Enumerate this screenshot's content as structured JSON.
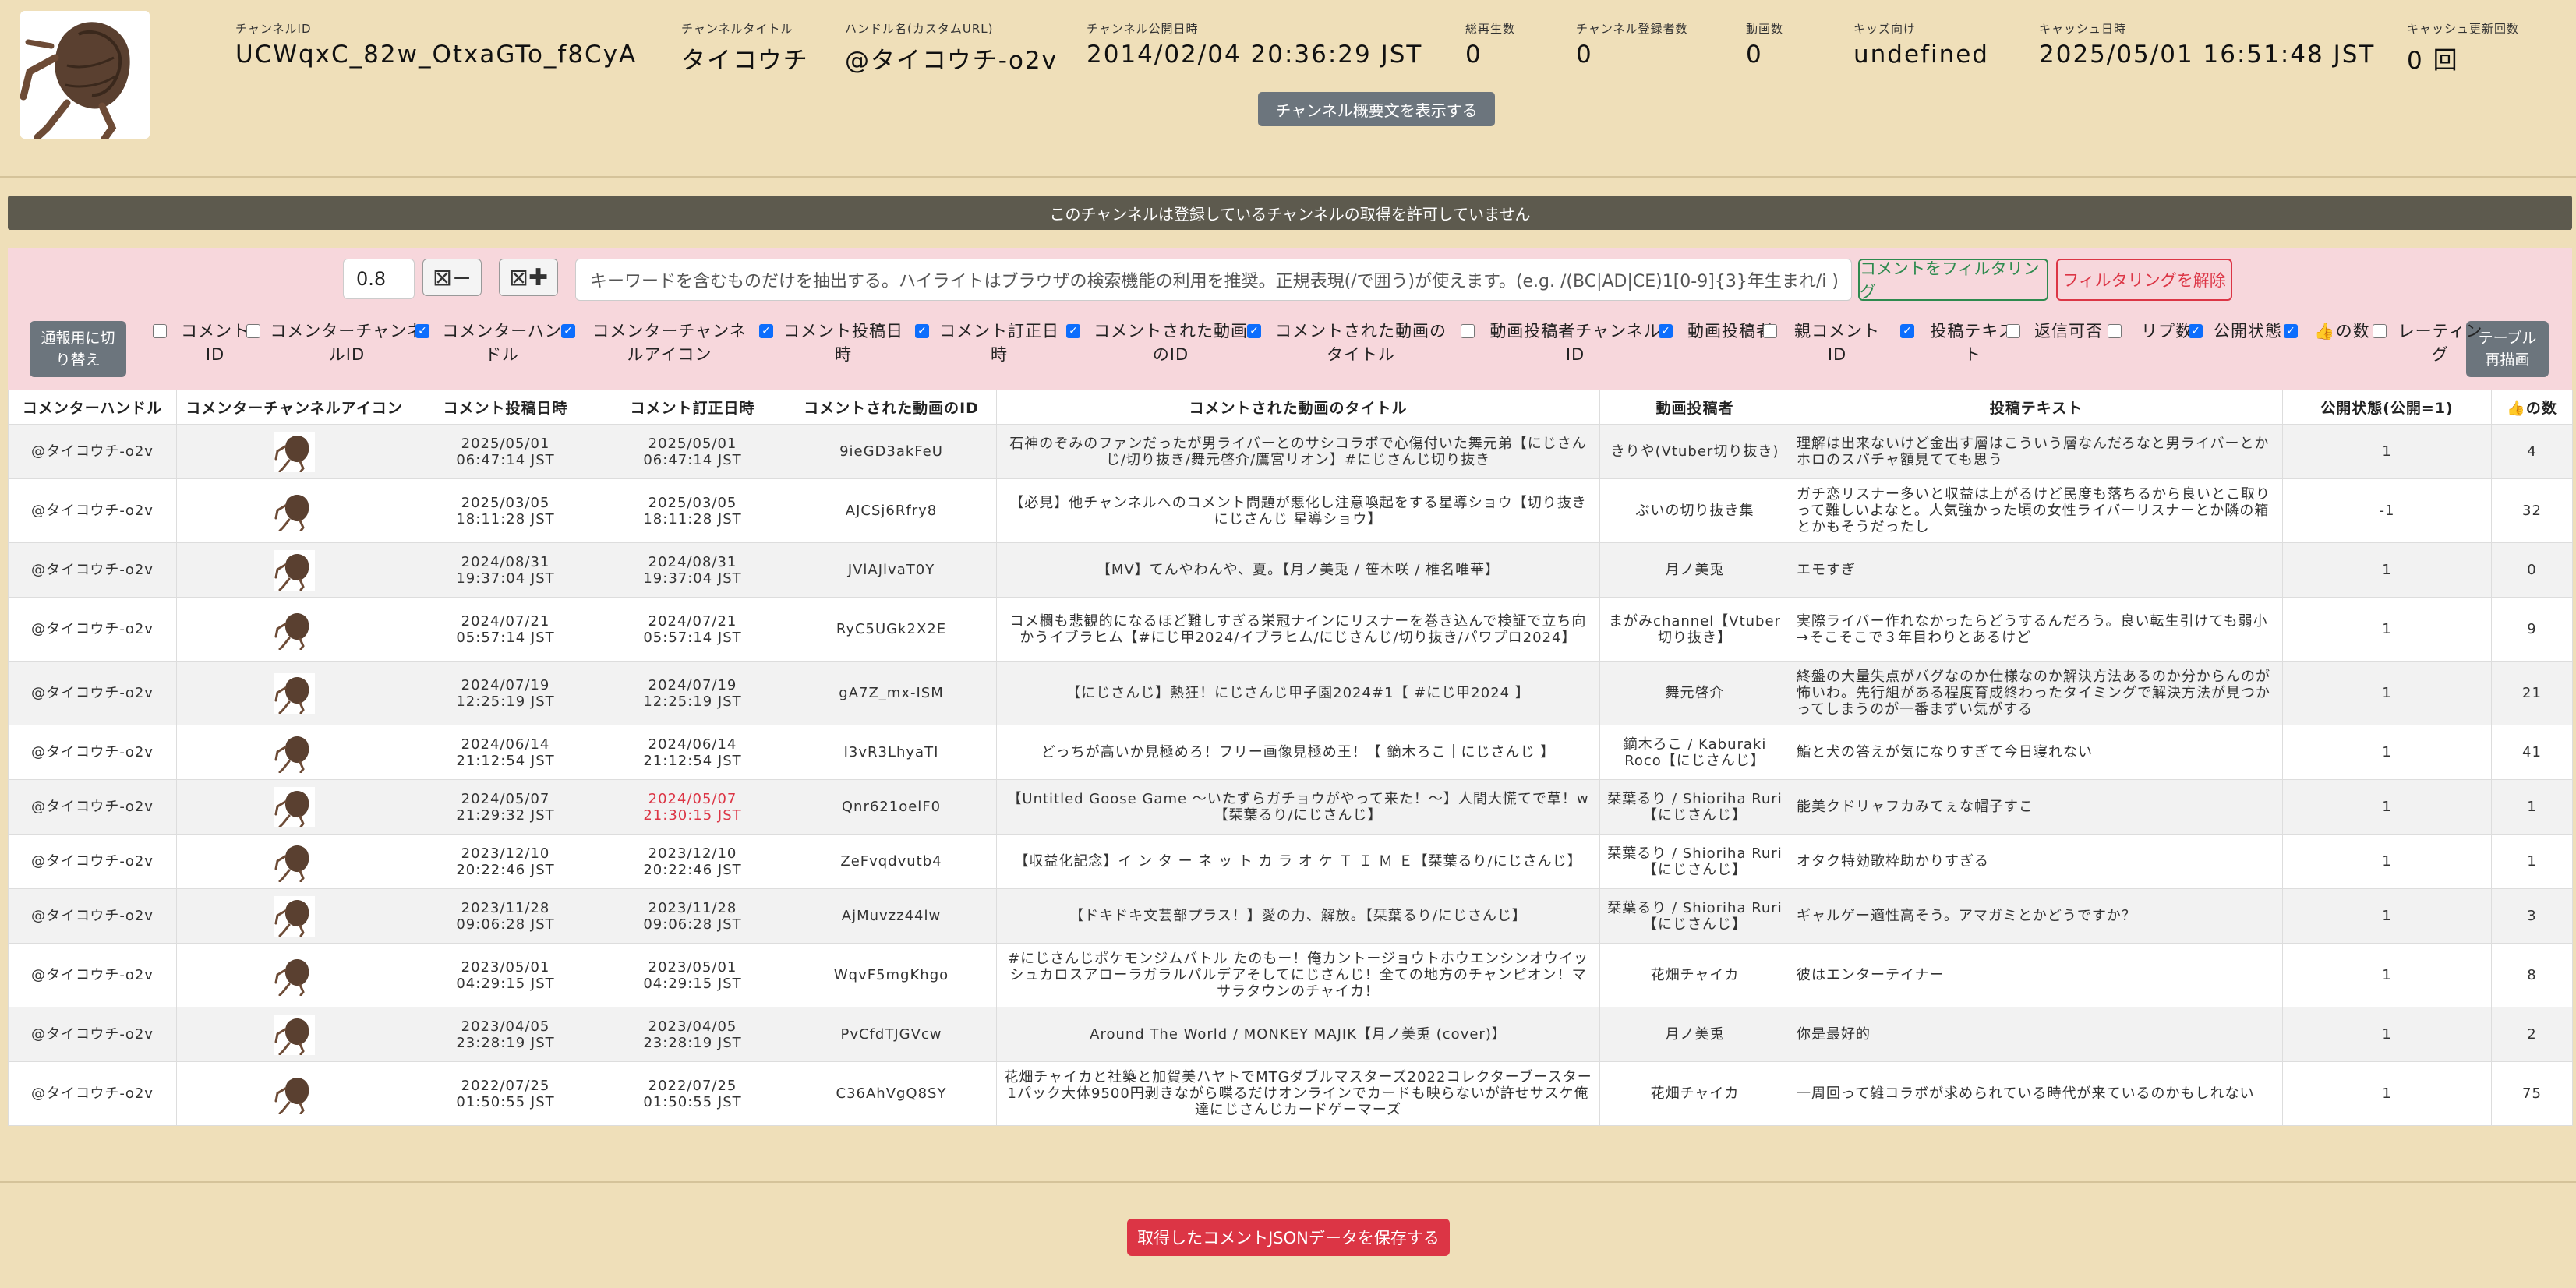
{
  "header": {
    "fields": [
      {
        "label": "チャンネルID",
        "value": "UCWqxC_82w_OtxaGTo_f8CyA"
      },
      {
        "label": "チャンネルタイトル",
        "value": "タイコウチ"
      },
      {
        "label": "ハンドル名(カスタムURL)",
        "value": "@タイコウチ-o2v"
      },
      {
        "label": "チャンネル公開日時",
        "value": "2014/02/04 20:36:29 JST"
      },
      {
        "label": "総再生数",
        "value": "0"
      },
      {
        "label": "チャンネル登録者数",
        "value": "0"
      },
      {
        "label": "動画数",
        "value": "0"
      },
      {
        "label": "キッズ向け",
        "value": "undefined"
      },
      {
        "label": "キャッシュ日時",
        "value": "2025/05/01 16:51:48 JST"
      },
      {
        "label": "キャッシュ更新回数",
        "value": "0 回"
      }
    ],
    "description_button": "チャンネル概要文を表示する"
  },
  "notice": "このチャンネルは登録しているチャンネルの取得を許可していません",
  "filter": {
    "threshold": "0.8",
    "shrink_button": "⊠−",
    "expand_button": "⊠✚",
    "keyword_placeholder": "キーワードを含むものだけを抽出する。ハイライトはブラウザの検索機能の利用を推奨。正規表現(/で囲う)が使えます。(e.g. /(BC|AD|CE)1[0-9]{3}年生まれ/i )",
    "filter_button": "コメントをフィルタリング",
    "clear_button": "フィルタリングを解除",
    "toggle_button": "通報用に切り替え",
    "redraw_button": "テーブル再描画"
  },
  "columns": [
    {
      "label": "コメントID",
      "checked": false
    },
    {
      "label": "コメンターチャンネルID",
      "checked": false
    },
    {
      "label": "コメンターハンドル",
      "checked": true
    },
    {
      "label": "コメンターチャンネルアイコン",
      "checked": true
    },
    {
      "label": "コメント投稿日時",
      "checked": true
    },
    {
      "label": "コメント訂正日時",
      "checked": true
    },
    {
      "label": "コメントされた動画のID",
      "checked": true
    },
    {
      "label": "コメントされた動画のタイトル",
      "checked": true
    },
    {
      "label": "動画投稿者チャンネルID",
      "checked": false
    },
    {
      "label": "動画投稿者",
      "checked": true
    },
    {
      "label": "親コメントID",
      "checked": false
    },
    {
      "label": "投稿テキスト",
      "checked": true
    },
    {
      "label": "返信可否",
      "checked": false
    },
    {
      "label": "リプ数",
      "checked": false
    },
    {
      "label": "公開状態",
      "checked": true
    },
    {
      "label": "👍の数",
      "checked": true
    },
    {
      "label": "レーティング",
      "checked": false
    }
  ],
  "table": {
    "headers": [
      "コメンターハンドル",
      "コメンターチャンネルアイコン",
      "コメント投稿日時",
      "コメント訂正日時",
      "コメントされた動画のID",
      "コメントされた動画のタイトル",
      "動画投稿者",
      "投稿テキスト",
      "公開状態(公開=1)",
      "👍の数"
    ],
    "rows": [
      {
        "handle": "@タイコウチ-o2v",
        "posted": [
          "2025/05/01",
          "06:47:14 JST"
        ],
        "edited": [
          "2025/05/01",
          "06:47:14 JST"
        ],
        "edited_changed": false,
        "video_id": "9ieGD3akFeU",
        "title": "石神のぞみのファンだったが男ライバーとのサシコラボで心傷付いた舞元弟【にじさんじ/切り抜き/舞元啓介/鷹宮リオン】#にじさんじ切り抜き",
        "uploader": "きりや(Vtuber切り抜き)",
        "text": "理解は出来ないけど金出す層はこういう層なんだろなと男ライバーとかホロのスバチャ額見てても思う",
        "status": "1",
        "likes": "4"
      },
      {
        "handle": "@タイコウチ-o2v",
        "posted": [
          "2025/03/05",
          "18:11:28 JST"
        ],
        "edited": [
          "2025/03/05",
          "18:11:28 JST"
        ],
        "edited_changed": false,
        "video_id": "AJCSj6Rfry8",
        "title": "【必見】他チャンネルへのコメント問題が悪化し注意喚起をする星導ショウ【切り抜き にじさんじ 星導ショウ】",
        "uploader": "ぶいの切り抜き集",
        "text": "ガチ恋リスナー多いと収益は上がるけど民度も落ちるから良いとこ取りって難しいよなと。人気強かった頃の女性ライバーリスナーとか隣の箱とかもそうだったし",
        "status": "-1",
        "likes": "32"
      },
      {
        "handle": "@タイコウチ-o2v",
        "posted": [
          "2024/08/31",
          "19:37:04 JST"
        ],
        "edited": [
          "2024/08/31",
          "19:37:04 JST"
        ],
        "edited_changed": false,
        "video_id": "JVlAJlvaT0Y",
        "title": "【MV】てんやわんや、夏。【月ノ美兎 / 笹木咲 / 椎名唯華】",
        "uploader": "月ノ美兎",
        "text": "エモすぎ",
        "status": "1",
        "likes": "0"
      },
      {
        "handle": "@タイコウチ-o2v",
        "posted": [
          "2024/07/21",
          "05:57:14 JST"
        ],
        "edited": [
          "2024/07/21",
          "05:57:14 JST"
        ],
        "edited_changed": false,
        "video_id": "RyC5UGk2X2E",
        "title": "コメ欄も悲観的になるほど難しすぎる栄冠ナインにリスナーを巻き込んで検証で立ち向かうイブラヒム【#にじ甲2024/イブラヒム/にじさんじ/切り抜き/パワプロ2024】",
        "uploader": "まがみchannel【Vtuber切り抜き】",
        "text": "実際ライバー作れなかったらどうするんだろう。良い転生引けても弱小→そこそこで３年目わりとあるけど",
        "status": "1",
        "likes": "9"
      },
      {
        "handle": "@タイコウチ-o2v",
        "posted": [
          "2024/07/19",
          "12:25:19 JST"
        ],
        "edited": [
          "2024/07/19",
          "12:25:19 JST"
        ],
        "edited_changed": false,
        "video_id": "gA7Z_mx-ISM",
        "title": "【にじさんじ】熱狂！にじさんじ甲子園2024#1【 #にじ甲2024 】",
        "uploader": "舞元啓介",
        "text": "終盤の大量失点がバグなのか仕様なのか解決方法あるのか分からんのが怖いわ。先行組がある程度育成終わったタイミングで解決方法が見つかってしまうのが一番まずい気がする",
        "status": "1",
        "likes": "21"
      },
      {
        "handle": "@タイコウチ-o2v",
        "posted": [
          "2024/06/14",
          "21:12:54 JST"
        ],
        "edited": [
          "2024/06/14",
          "21:12:54 JST"
        ],
        "edited_changed": false,
        "video_id": "I3vR3LhyaTI",
        "title": "どっちが高いか見極めろ！フリー画像見極め王！【 鏑木ろこ｜にじさんじ 】",
        "uploader": "鏑木ろこ / Kaburaki Roco【にじさんじ】",
        "text": "鮨と犬の答えが気になりすぎて今日寝れない",
        "status": "1",
        "likes": "41"
      },
      {
        "handle": "@タイコウチ-o2v",
        "posted": [
          "2024/05/07",
          "21:29:32 JST"
        ],
        "edited": [
          "2024/05/07",
          "21:30:15 JST"
        ],
        "edited_changed": true,
        "video_id": "Qnr621oelF0",
        "title": "【Untitled Goose Game 〜いたずらガチョウがやって来た！〜】人間大慌てで草！w【栞葉るり/にじさんじ】",
        "uploader": "栞葉るり / Shioriha Ruri【にじさんじ】",
        "text": "能美クドリャフカみてぇな帽子すこ",
        "status": "1",
        "likes": "1"
      },
      {
        "handle": "@タイコウチ-o2v",
        "posted": [
          "2023/12/10",
          "20:22:46 JST"
        ],
        "edited": [
          "2023/12/10",
          "20:22:46 JST"
        ],
        "edited_changed": false,
        "video_id": "ZeFvqdvutb4",
        "title": "【収益化記念】イ ン タ ー ネ ッ ト カ ラ オ ケ Ｔ Ｉ Ｍ Ｅ【栞葉るり/にじさんじ】",
        "uploader": "栞葉るり / Shioriha Ruri【にじさんじ】",
        "text": "オタク特効歌枠助かりすぎる",
        "status": "1",
        "likes": "1"
      },
      {
        "handle": "@タイコウチ-o2v",
        "posted": [
          "2023/11/28",
          "09:06:28 JST"
        ],
        "edited": [
          "2023/11/28",
          "09:06:28 JST"
        ],
        "edited_changed": false,
        "video_id": "AjMuvzz44lw",
        "title": "【ドキドキ文芸部プラス！】愛の力、解放。【栞葉るり/にじさんじ】",
        "uploader": "栞葉るり / Shioriha Ruri【にじさんじ】",
        "text": "ギャルゲー適性高そう。アマガミとかどうですか？",
        "status": "1",
        "likes": "3"
      },
      {
        "handle": "@タイコウチ-o2v",
        "posted": [
          "2023/05/01",
          "04:29:15 JST"
        ],
        "edited": [
          "2023/05/01",
          "04:29:15 JST"
        ],
        "edited_changed": false,
        "video_id": "WqvF5mgKhgo",
        "title": "#にじさんじポケモンジムバトル たのもー！俺カントージョウトホウエンシンオウイッシュカロスアローラガラルパルデアそしてにじさんじ！全ての地方のチャンピオン！マサラタウンのチャイカ！",
        "uploader": "花畑チャイカ",
        "text": "彼はエンターテイナー",
        "status": "1",
        "likes": "8"
      },
      {
        "handle": "@タイコウチ-o2v",
        "posted": [
          "2023/04/05",
          "23:28:19 JST"
        ],
        "edited": [
          "2023/04/05",
          "23:28:19 JST"
        ],
        "edited_changed": false,
        "video_id": "PvCfdTJGVcw",
        "title": "Around The World / MONKEY MAJIK【月ノ美兎 (cover)】",
        "uploader": "月ノ美兎",
        "text": "你是最好的",
        "status": "1",
        "likes": "2"
      },
      {
        "handle": "@タイコウチ-o2v",
        "posted": [
          "2022/07/25",
          "01:50:55 JST"
        ],
        "edited": [
          "2022/07/25",
          "01:50:55 JST"
        ],
        "edited_changed": false,
        "video_id": "C36AhVgQ8SY",
        "title": "花畑チャイカと社築と加賀美ハヤトでMTGダブルマスターズ2022コレクターブースター1パック大体9500円剥きながら喋るだけオンラインでカードも映らないが許せサスケ俺達にじさんじカードゲーマーズ",
        "uploader": "花畑チャイカ",
        "text": "一周回って雑コラボが求められている時代が来ているのかもしれない",
        "status": "1",
        "likes": "75"
      }
    ]
  },
  "save_button": "取得したコメントJSONデータを保存する"
}
